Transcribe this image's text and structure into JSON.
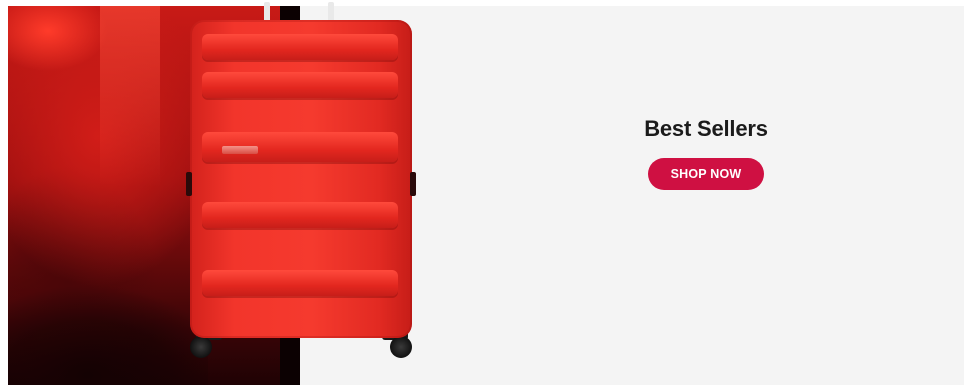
{
  "banner": {
    "title": "Best Sellers",
    "cta_label": "SHOP NOW"
  },
  "colors": {
    "cta_background": "#cf1042",
    "title_text": "#1b1b1b",
    "panel_background": "#f4f4f4",
    "suitcase_red": "#f2352b"
  },
  "images": {
    "hero": "red-suitcase-product-photo"
  }
}
